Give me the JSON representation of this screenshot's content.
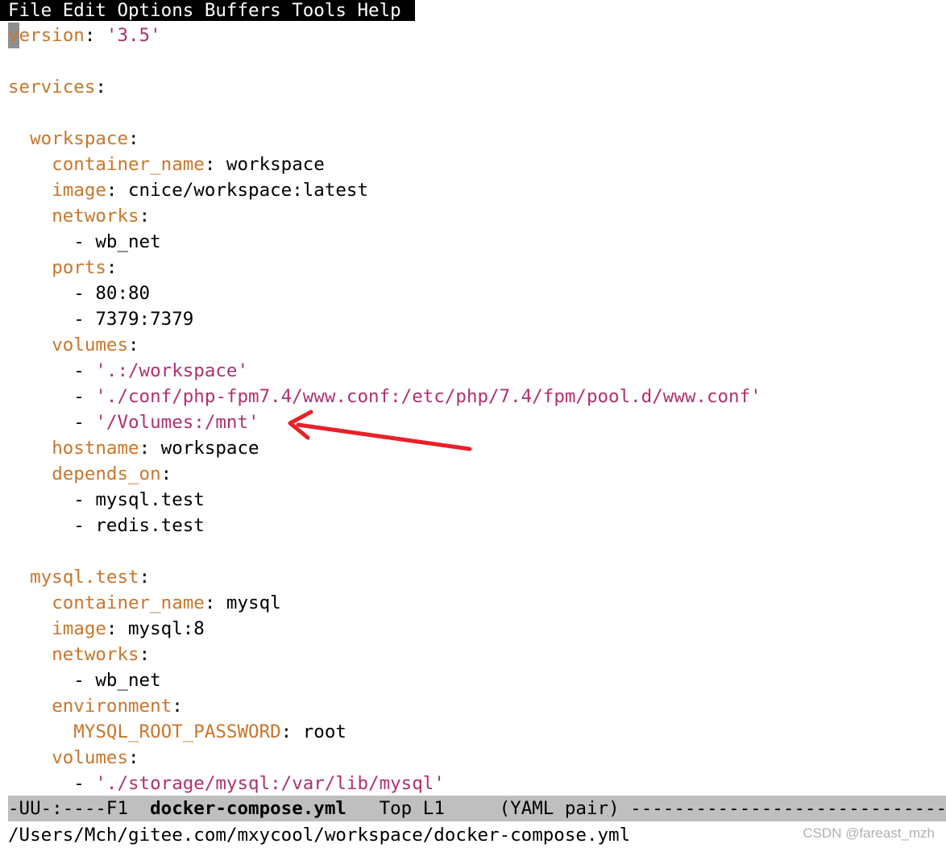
{
  "menubar": {
    "items": [
      "File",
      "Edit",
      "Options",
      "Buffers",
      "Tools",
      "Help"
    ]
  },
  "editor": {
    "cursor_char": "v",
    "lines": [
      [
        {
          "t": "ersion",
          "c": "k"
        },
        {
          "t": ": ",
          "c": "v"
        },
        {
          "t": "'3.5'",
          "c": "s"
        }
      ],
      [],
      [
        {
          "t": "services",
          "c": "k"
        },
        {
          "t": ":",
          "c": "v"
        }
      ],
      [],
      [
        {
          "t": "  ",
          "c": "v"
        },
        {
          "t": "workspace",
          "c": "k"
        },
        {
          "t": ":",
          "c": "v"
        }
      ],
      [
        {
          "t": "    ",
          "c": "v"
        },
        {
          "t": "container_name",
          "c": "k"
        },
        {
          "t": ": workspace",
          "c": "v"
        }
      ],
      [
        {
          "t": "    ",
          "c": "v"
        },
        {
          "t": "image",
          "c": "k"
        },
        {
          "t": ": cnice/workspace:latest",
          "c": "v"
        }
      ],
      [
        {
          "t": "    ",
          "c": "v"
        },
        {
          "t": "networks",
          "c": "k"
        },
        {
          "t": ":",
          "c": "v"
        }
      ],
      [
        {
          "t": "      - wb_net",
          "c": "v"
        }
      ],
      [
        {
          "t": "    ",
          "c": "v"
        },
        {
          "t": "ports",
          "c": "k"
        },
        {
          "t": ":",
          "c": "v"
        }
      ],
      [
        {
          "t": "      - 80:80",
          "c": "v"
        }
      ],
      [
        {
          "t": "      - 7379:7379",
          "c": "v"
        }
      ],
      [
        {
          "t": "    ",
          "c": "v"
        },
        {
          "t": "volumes",
          "c": "k"
        },
        {
          "t": ":",
          "c": "v"
        }
      ],
      [
        {
          "t": "      - ",
          "c": "v"
        },
        {
          "t": "'.:/workspace'",
          "c": "s"
        }
      ],
      [
        {
          "t": "      - ",
          "c": "v"
        },
        {
          "t": "'./conf/php-fpm7.4/www.conf:/etc/php/7.4/fpm/pool.d/www.conf'",
          "c": "s"
        }
      ],
      [
        {
          "t": "      - ",
          "c": "v"
        },
        {
          "t": "'/Volumes:/mnt'",
          "c": "s"
        }
      ],
      [
        {
          "t": "    ",
          "c": "v"
        },
        {
          "t": "hostname",
          "c": "k"
        },
        {
          "t": ": workspace",
          "c": "v"
        }
      ],
      [
        {
          "t": "    ",
          "c": "v"
        },
        {
          "t": "depends_on",
          "c": "k"
        },
        {
          "t": ":",
          "c": "v"
        }
      ],
      [
        {
          "t": "      - mysql.test",
          "c": "v"
        }
      ],
      [
        {
          "t": "      - redis.test",
          "c": "v"
        }
      ],
      [],
      [
        {
          "t": "  ",
          "c": "v"
        },
        {
          "t": "mysql.test",
          "c": "k"
        },
        {
          "t": ":",
          "c": "v"
        }
      ],
      [
        {
          "t": "    ",
          "c": "v"
        },
        {
          "t": "container_name",
          "c": "k"
        },
        {
          "t": ": mysql",
          "c": "v"
        }
      ],
      [
        {
          "t": "    ",
          "c": "v"
        },
        {
          "t": "image",
          "c": "k"
        },
        {
          "t": ": mysql:8",
          "c": "v"
        }
      ],
      [
        {
          "t": "    ",
          "c": "v"
        },
        {
          "t": "networks",
          "c": "k"
        },
        {
          "t": ":",
          "c": "v"
        }
      ],
      [
        {
          "t": "      - wb_net",
          "c": "v"
        }
      ],
      [
        {
          "t": "    ",
          "c": "v"
        },
        {
          "t": "environment",
          "c": "k"
        },
        {
          "t": ":",
          "c": "v"
        }
      ],
      [
        {
          "t": "      ",
          "c": "v"
        },
        {
          "t": "MYSQL_ROOT_PASSWORD",
          "c": "k"
        },
        {
          "t": ": root",
          "c": "v"
        }
      ],
      [
        {
          "t": "    ",
          "c": "v"
        },
        {
          "t": "volumes",
          "c": "k"
        },
        {
          "t": ":",
          "c": "v"
        }
      ],
      [
        {
          "t": "      - ",
          "c": "v"
        },
        {
          "t": "'./storage/mysql:/var/lib/mysql'",
          "c": "s"
        }
      ]
    ]
  },
  "modeline": {
    "status": "-UU-:----F1  ",
    "buffer_name": "docker-compose.yml",
    "position": "   Top L1     ",
    "mode": "(YAML pair) ",
    "fill": "----------------------------------------"
  },
  "minibuffer": {
    "path": "/Users/Mch/gitee.com/mxycool/workspace/docker-compose.yml"
  },
  "watermark": "CSDN @fareast_mzh",
  "colors": {
    "key": "#c8762b",
    "string": "#b0306f",
    "text": "#000000",
    "modeline_bg": "#bfbfbf",
    "arrow": "#e8202a"
  },
  "annotation": {
    "arrow_icon": "red-arrow-icon"
  }
}
